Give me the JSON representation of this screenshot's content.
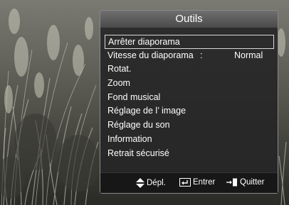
{
  "panel": {
    "title": "Outils"
  },
  "menu": {
    "items": [
      {
        "label": "Arrêter diaporama",
        "selected": true
      },
      {
        "label": "Vitesse du diaporama",
        "separator": ":",
        "value": "Normal"
      },
      {
        "label": "Rotat."
      },
      {
        "label": "Zoom"
      },
      {
        "label": "Fond musical"
      },
      {
        "label": "Réglage de l’ image"
      },
      {
        "label": "Réglage du son"
      },
      {
        "label": "Information"
      },
      {
        "label": "Retrait sécurisé"
      }
    ]
  },
  "footer": {
    "move_label": "Dépl.",
    "enter_label": "Entrer",
    "exit_label": "Quitter"
  },
  "colors": {
    "panel_bg": "#262626",
    "title_bar": "#5a5a5a",
    "text": "#ffffff",
    "selection_border": "#d9d9d9"
  },
  "icons": {
    "move": "up-down-arrows-icon",
    "enter": "enter-icon",
    "exit": "exit-door-icon"
  }
}
